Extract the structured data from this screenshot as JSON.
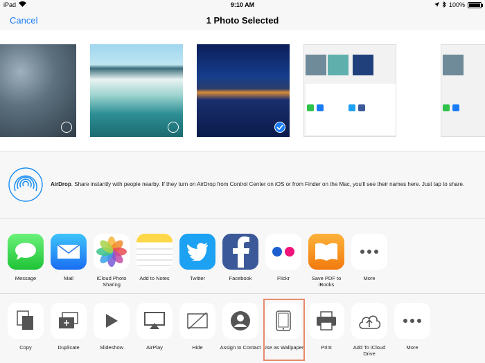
{
  "status": {
    "device": "iPad",
    "time": "9:10 AM",
    "battery": "100%",
    "battery_level": 1.0
  },
  "nav": {
    "cancel": "Cancel",
    "title": "1 Photo Selected"
  },
  "airdrop": {
    "title": "AirDrop",
    "description": ". Share instantly with people nearby. If they turn on AirDrop from Control Center on iOS or from Finder on the Mac, you'll see their names here. Just tap to share."
  },
  "apps": [
    {
      "label": "Message",
      "icon": "messages-icon"
    },
    {
      "label": "Mail",
      "icon": "mail-icon"
    },
    {
      "label": "iCloud Photo Sharing",
      "icon": "photos-icon"
    },
    {
      "label": "Add to Notes",
      "icon": "notes-icon"
    },
    {
      "label": "Twitter",
      "icon": "twitter-icon"
    },
    {
      "label": "Facebook",
      "icon": "facebook-icon"
    },
    {
      "label": "Flickr",
      "icon": "flickr-icon"
    },
    {
      "label": "Save PDF to iBooks",
      "icon": "ibooks-icon"
    },
    {
      "label": "More",
      "icon": "more-icon"
    }
  ],
  "actions": [
    {
      "label": "Copy",
      "icon": "copy-icon"
    },
    {
      "label": "Duplicate",
      "icon": "duplicate-icon"
    },
    {
      "label": "Slideshow",
      "icon": "play-icon"
    },
    {
      "label": "AirPlay",
      "icon": "airplay-icon"
    },
    {
      "label": "Hide",
      "icon": "hide-icon"
    },
    {
      "label": "Assign to Contact",
      "icon": "contact-icon"
    },
    {
      "label": "Use as Wallpaper",
      "icon": "ipad-icon"
    },
    {
      "label": "Print",
      "icon": "printer-icon"
    },
    {
      "label": "Add To iCloud Drive",
      "icon": "icloud-upload-icon"
    },
    {
      "label": "More",
      "icon": "more-icon"
    }
  ]
}
